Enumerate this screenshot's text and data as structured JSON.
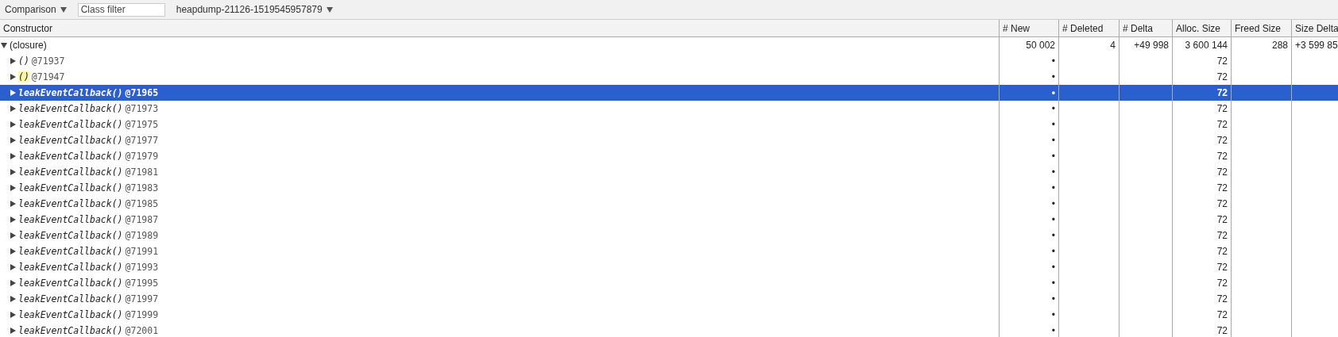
{
  "toolbar": {
    "view": "Comparison",
    "filter": {
      "placeholder": "Class filter"
    },
    "snapshot": "heapdump-21126-1519545957879"
  },
  "table": {
    "columns": [
      "Constructor",
      "# New",
      "# Deleted",
      "# Delta",
      "Alloc. Size",
      "Freed Size",
      "Size Delta"
    ],
    "rows": [
      {
        "expanded": true,
        "selected": false,
        "cells": [
          "(closure)",
          "50 002",
          "4",
          "+49 998",
          "3 600 144",
          "288",
          "+3 599 85"
        ],
        "children": [
          {
            "id": "@71937",
            "selected": false,
            "highlighted": false,
            "cells": [
              "()",
              "•",
              "",
              "",
              "72",
              "",
              ""
            ]
          },
          {
            "id": "@71947",
            "selected": false,
            "highlighted": true,
            "cells": [
              "()",
              "•",
              "",
              "",
              "72",
              "",
              ""
            ]
          },
          {
            "id": "@71965",
            "selected": true,
            "highlighted": false,
            "cells": [
              "leakEventCallback()",
              "•",
              "",
              "",
              "72",
              "",
              ""
            ]
          },
          {
            "id": "@71973",
            "selected": false,
            "highlighted": false,
            "cells": [
              "leakEventCallback()",
              "•",
              "",
              "",
              "72",
              "",
              ""
            ]
          },
          {
            "id": "@71975",
            "selected": false,
            "highlighted": false,
            "cells": [
              "leakEventCallback()",
              "•",
              "",
              "",
              "72",
              "",
              ""
            ]
          },
          {
            "id": "@71977",
            "selected": false,
            "highlighted": false,
            "cells": [
              "leakEventCallback()",
              "•",
              "",
              "",
              "72",
              "",
              ""
            ]
          },
          {
            "id": "@71979",
            "selected": false,
            "highlighted": false,
            "cells": [
              "leakEventCallback()",
              "•",
              "",
              "",
              "72",
              "",
              ""
            ]
          },
          {
            "id": "@71981",
            "selected": false,
            "highlighted": false,
            "cells": [
              "leakEventCallback()",
              "•",
              "",
              "",
              "72",
              "",
              ""
            ]
          },
          {
            "id": "@71983",
            "selected": false,
            "highlighted": false,
            "cells": [
              "leakEventCallback()",
              "•",
              "",
              "",
              "72",
              "",
              ""
            ]
          },
          {
            "id": "@71985",
            "selected": false,
            "highlighted": false,
            "cells": [
              "leakEventCallback()",
              "•",
              "",
              "",
              "72",
              "",
              ""
            ]
          },
          {
            "id": "@71987",
            "selected": false,
            "highlighted": false,
            "cells": [
              "leakEventCallback()",
              "•",
              "",
              "",
              "72",
              "",
              ""
            ]
          },
          {
            "id": "@71989",
            "selected": false,
            "highlighted": false,
            "cells": [
              "leakEventCallback()",
              "•",
              "",
              "",
              "72",
              "",
              ""
            ]
          },
          {
            "id": "@71991",
            "selected": false,
            "highlighted": false,
            "cells": [
              "leakEventCallback()",
              "•",
              "",
              "",
              "72",
              "",
              ""
            ]
          },
          {
            "id": "@71993",
            "selected": false,
            "highlighted": false,
            "cells": [
              "leakEventCallback()",
              "•",
              "",
              "",
              "72",
              "",
              ""
            ]
          },
          {
            "id": "@71995",
            "selected": false,
            "highlighted": false,
            "cells": [
              "leakEventCallback()",
              "•",
              "",
              "",
              "72",
              "",
              ""
            ]
          },
          {
            "id": "@71997",
            "selected": false,
            "highlighted": false,
            "cells": [
              "leakEventCallback()",
              "•",
              "",
              "",
              "72",
              "",
              ""
            ]
          },
          {
            "id": "@71999",
            "selected": false,
            "highlighted": false,
            "cells": [
              "leakEventCallback()",
              "•",
              "",
              "",
              "72",
              "",
              ""
            ]
          },
          {
            "id": "@72001",
            "selected": false,
            "highlighted": false,
            "cells": [
              "leakEventCallback()",
              "•",
              "",
              "",
              "72",
              "",
              ""
            ]
          }
        ]
      }
    ]
  }
}
